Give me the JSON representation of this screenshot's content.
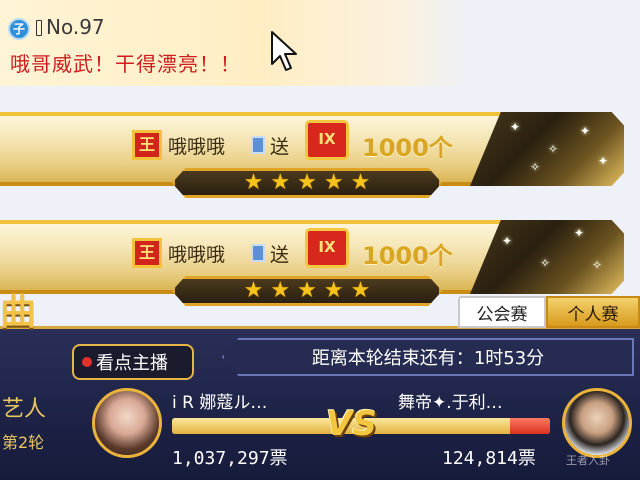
{
  "chat": {
    "level_badge": "子",
    "user_no": "No.97",
    "message": "哦哥威武！干得漂亮！！"
  },
  "gift_banners": [
    {
      "badge": "王",
      "sender": "哦哦哦",
      "action": "送",
      "gift_icon_label": "ⅠⅩ",
      "count": "1000个",
      "stars": 5
    },
    {
      "badge": "王",
      "sender": "哦哦哦",
      "action": "送",
      "gift_icon_label": "ⅠⅩ",
      "count": "1000个",
      "stars": 5
    }
  ],
  "left_panel": {
    "title": "曲",
    "subtitle": "艺人",
    "round": "第2轮"
  },
  "tabs": {
    "guild": "公会赛",
    "personal": "个人赛",
    "active": "personal"
  },
  "watch": {
    "label": "看点主播"
  },
  "timer": {
    "label": "距离本轮结束还有：",
    "value": "1时53分"
  },
  "pk": {
    "left_name": "i  R 娜蔻ル…",
    "right_name": "舞帝✦.于利…",
    "left_votes": "1,037,297票",
    "right_votes": "124,814票",
    "left_share": 0.893,
    "vs_label": "VS"
  },
  "watermark": "王者入卦",
  "colors": {
    "gold": "#f2c23a",
    "chat_red": "#cc1e1e",
    "panel_navy": "#1d2246",
    "bar_red": "#d8321f"
  },
  "icons": [
    "level-badge-icon",
    "mouse-cursor-icon",
    "king-badge-icon",
    "vip-icon",
    "gift-icon",
    "star-icon",
    "live-dot-icon"
  ]
}
